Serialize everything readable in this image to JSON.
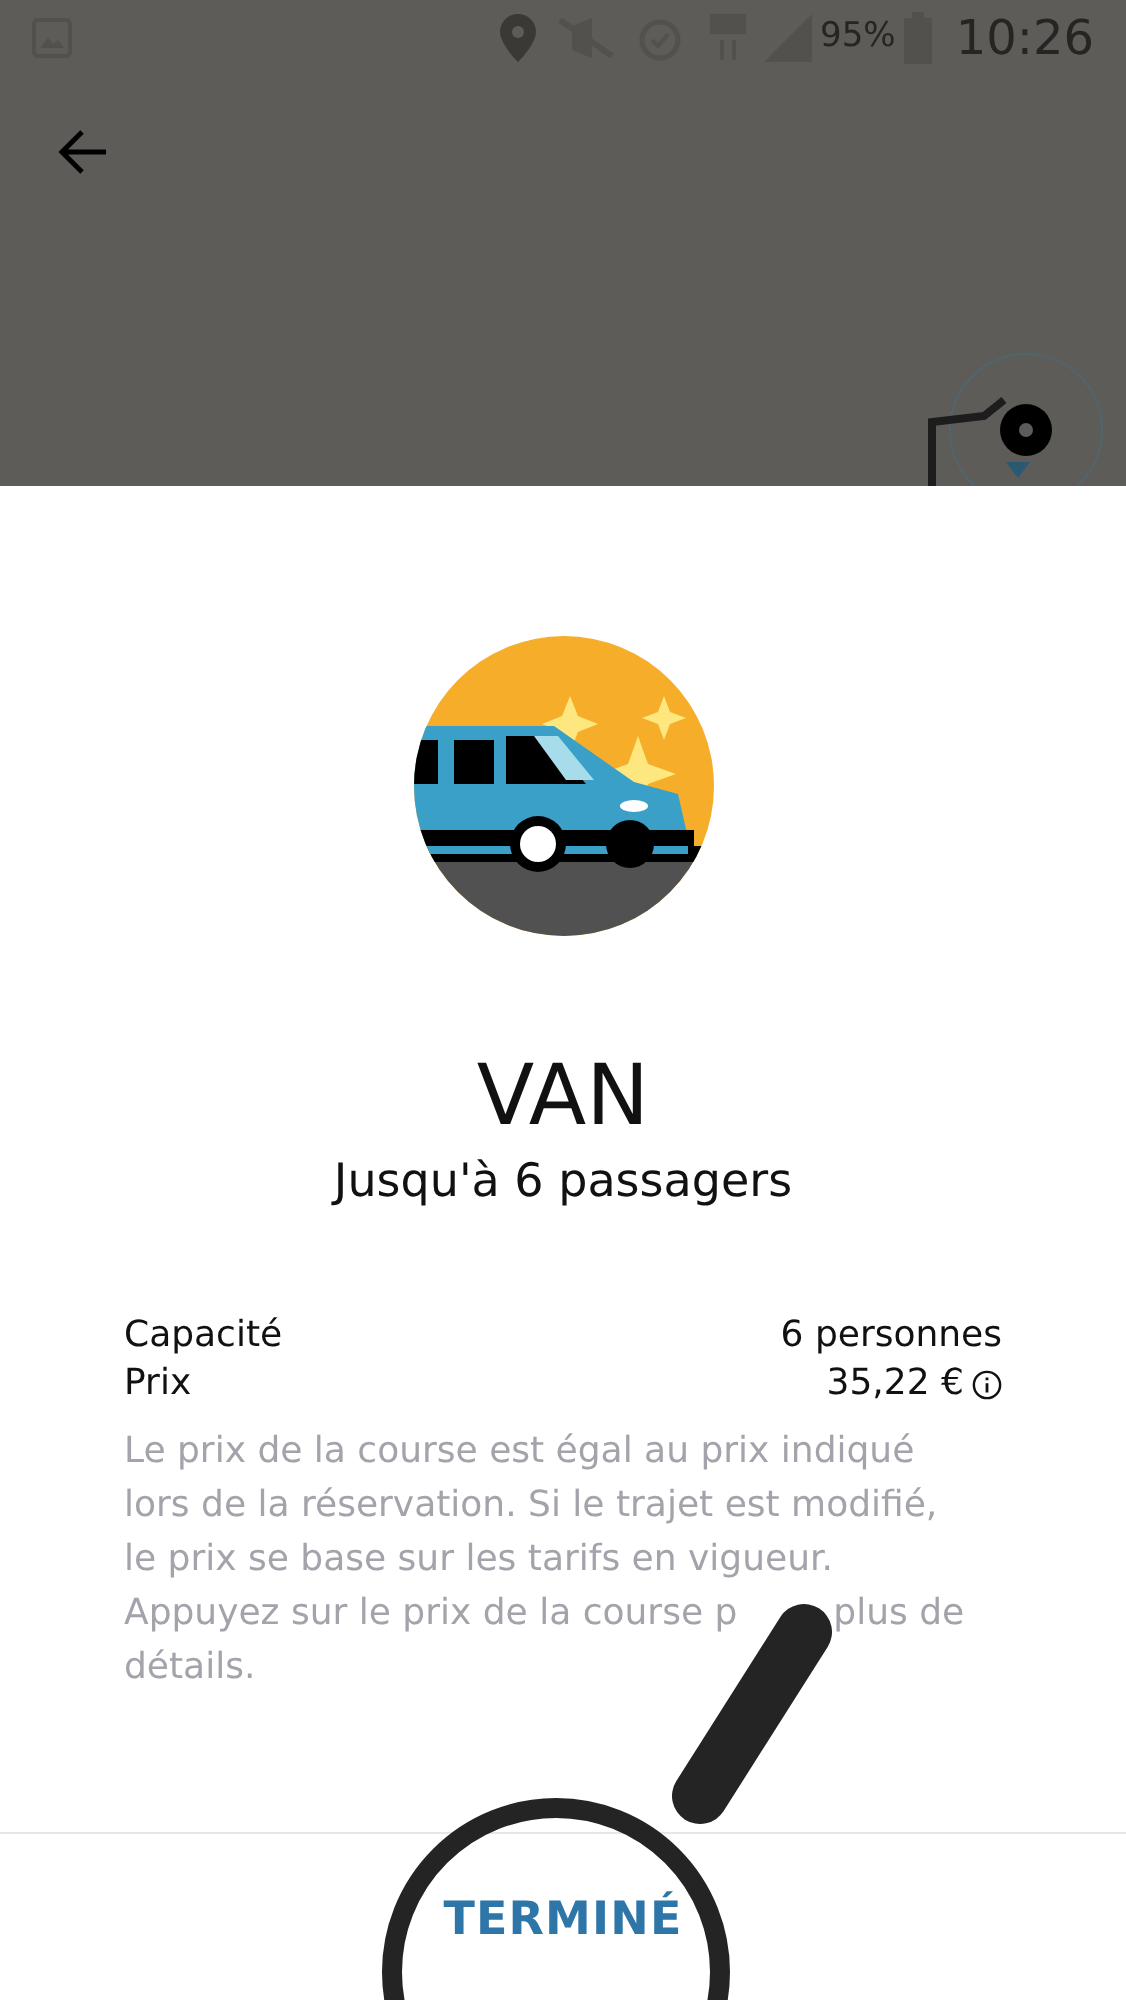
{
  "status_bar": {
    "battery": "95%",
    "time": "10:26"
  },
  "vehicle": {
    "name": "VAN",
    "subtitle": "Jusqu'à 6 passagers"
  },
  "details": [
    {
      "label": "Capacité",
      "value": "6 personnes",
      "info": false
    },
    {
      "label": "Prix",
      "value": "35,22 €",
      "info": true
    }
  ],
  "description_lines": [
    [
      "Le prix de la course est égal au prix indiqué"
    ],
    [
      "lors de la réservation. Si le trajet est modifié,"
    ],
    [
      "le prix se base sur les tarifs en vigueur."
    ],
    [
      "Appuyez sur le prix de la course p",
      "plus de"
    ],
    [
      "détails."
    ]
  ],
  "done_button": "TERMINÉ"
}
